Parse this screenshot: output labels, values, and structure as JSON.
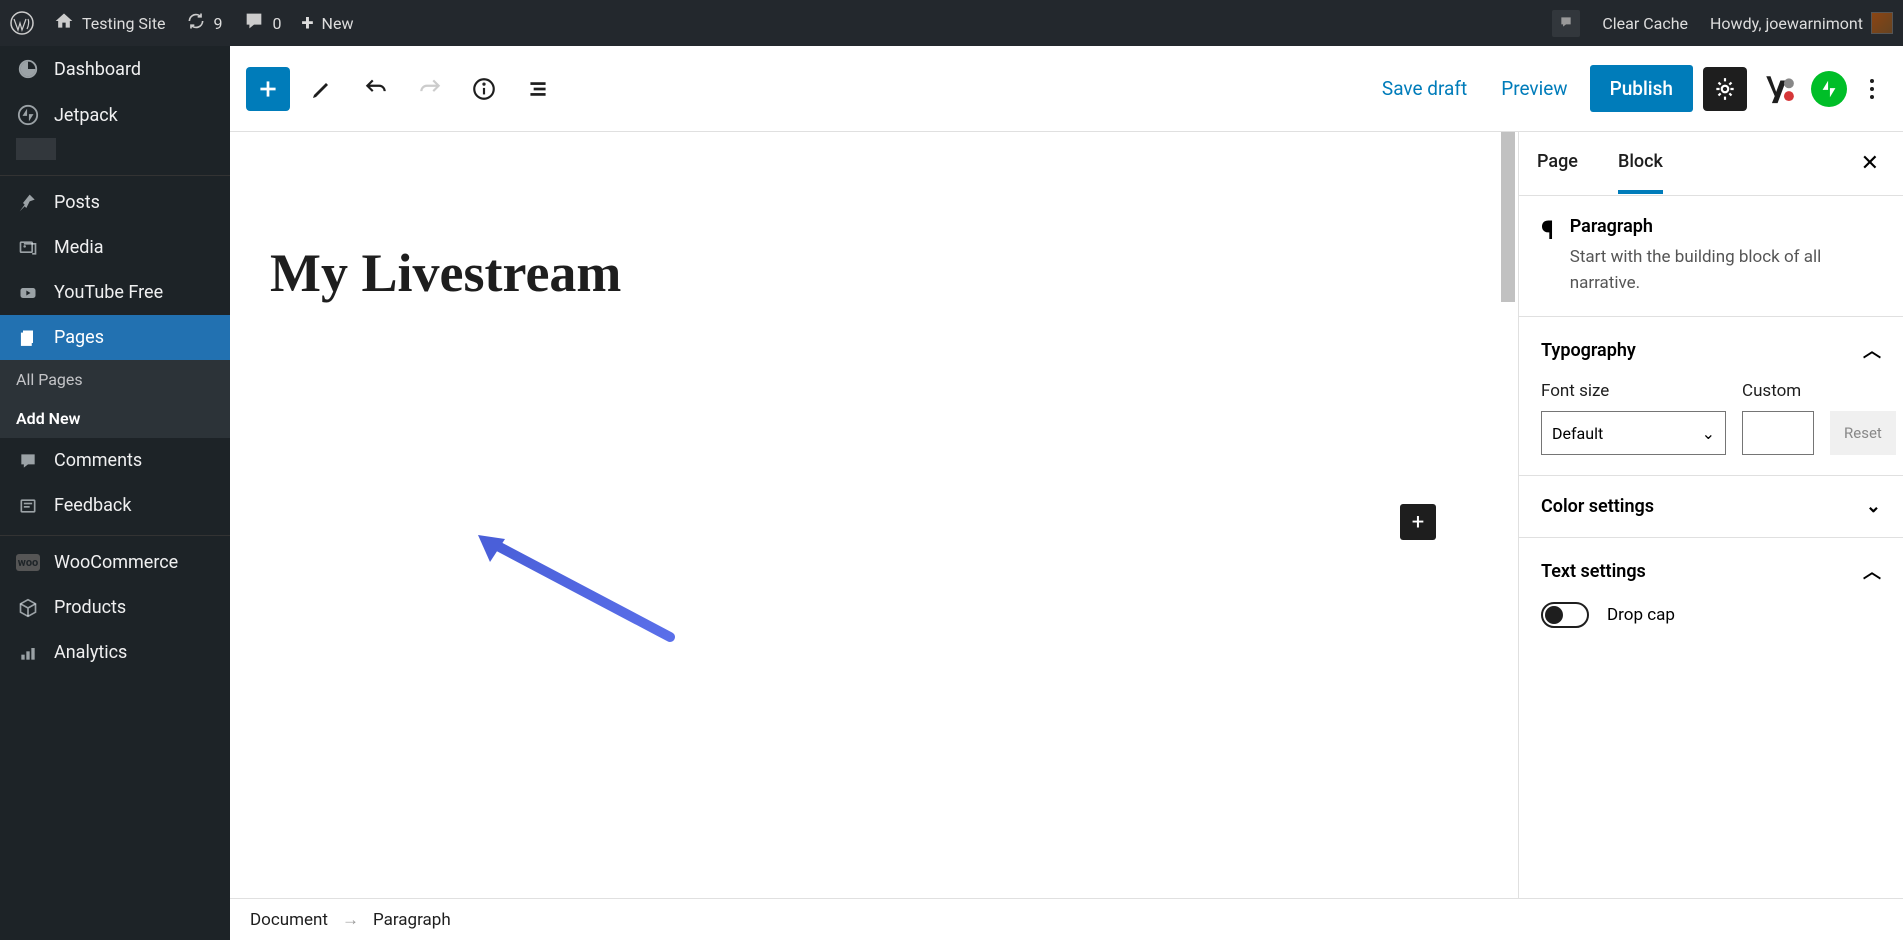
{
  "adminbar": {
    "site_name": "Testing Site",
    "updates_count": "9",
    "comments_count": "0",
    "new_label": "New",
    "clear_cache": "Clear Cache",
    "howdy": "Howdy, joewarnimont"
  },
  "sidebar": {
    "dashboard": "Dashboard",
    "jetpack": "Jetpack",
    "posts": "Posts",
    "media": "Media",
    "youtube": "YouTube Free",
    "pages": "Pages",
    "all_pages": "All Pages",
    "add_new": "Add New",
    "comments": "Comments",
    "feedback": "Feedback",
    "woocommerce": "WooCommerce",
    "products": "Products",
    "analytics": "Analytics"
  },
  "toolbar": {
    "save_draft": "Save draft",
    "preview": "Preview",
    "publish": "Publish"
  },
  "content": {
    "title": "My Livestream"
  },
  "panel": {
    "tab_page": "Page",
    "tab_block": "Block",
    "block_name": "Paragraph",
    "block_desc": "Start with the building block of all narrative.",
    "typography": "Typography",
    "font_size_label": "Font size",
    "custom_label": "Custom",
    "font_default": "Default",
    "reset": "Reset",
    "color_settings": "Color settings",
    "text_settings": "Text settings",
    "drop_cap": "Drop cap"
  },
  "breadcrumb": {
    "doc": "Document",
    "block": "Paragraph"
  }
}
